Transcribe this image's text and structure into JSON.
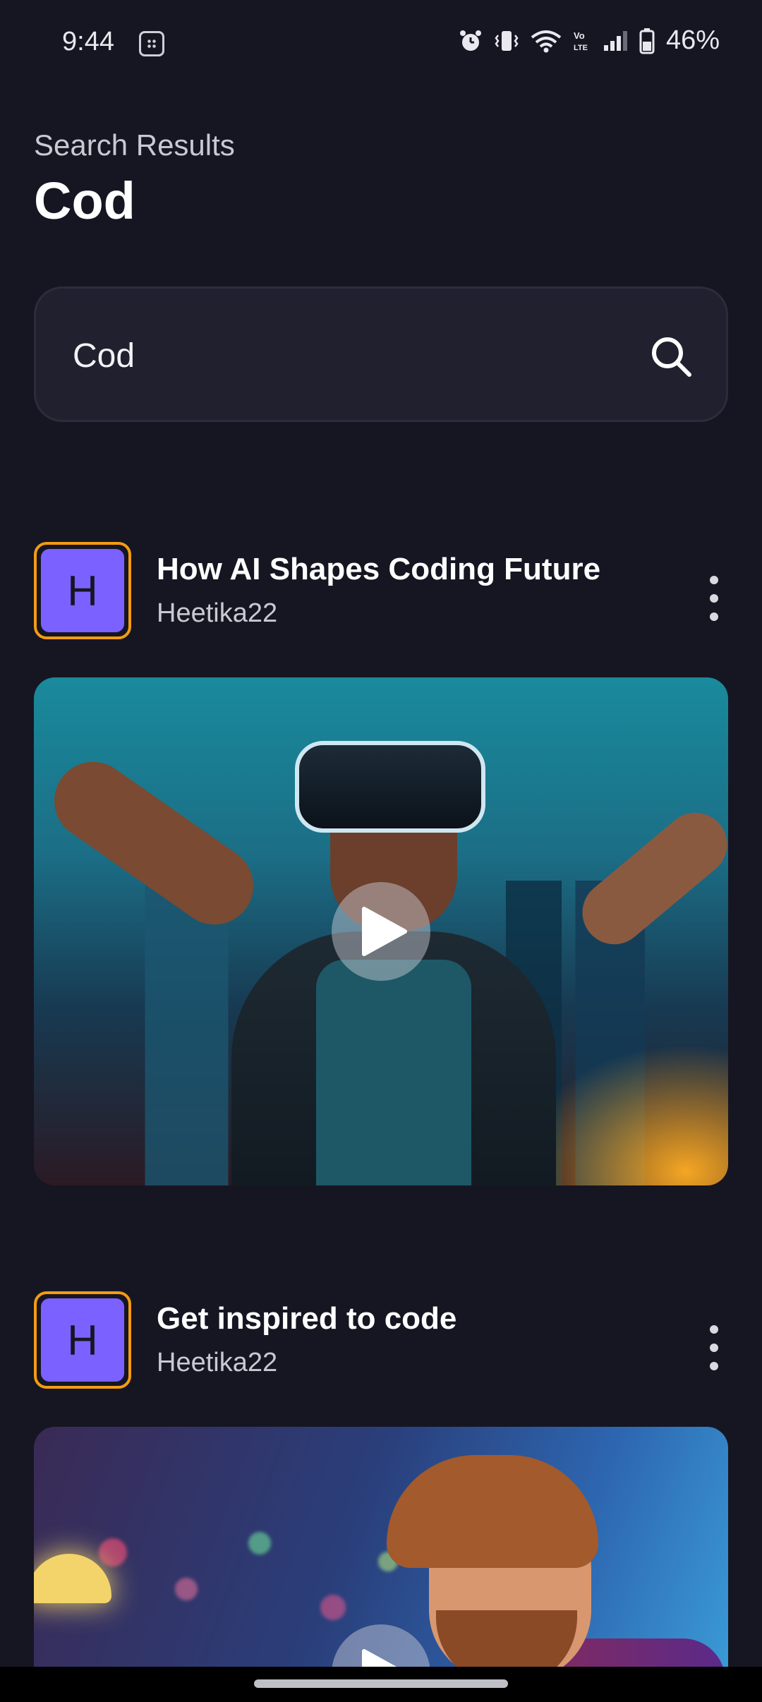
{
  "status_bar": {
    "time": "9:44",
    "battery": "46%",
    "icons": [
      "calendar-icon",
      "alarm-icon",
      "vibrate-icon",
      "wifi-icon",
      "volte-icon",
      "signal-icon",
      "battery-icon"
    ]
  },
  "header": {
    "subtitle": "Search Results",
    "title": "Cod"
  },
  "search": {
    "value": "Cod",
    "icon": "search-icon"
  },
  "posts": [
    {
      "avatar_letter": "H",
      "title": "How AI Shapes Coding Future",
      "author": "Heetika22"
    },
    {
      "avatar_letter": "H",
      "title": "Get inspired to code",
      "author": "Heetika22"
    }
  ],
  "colors": {
    "background": "#161622",
    "accent": "#7b61ff",
    "avatar_border": "#f39c12"
  }
}
